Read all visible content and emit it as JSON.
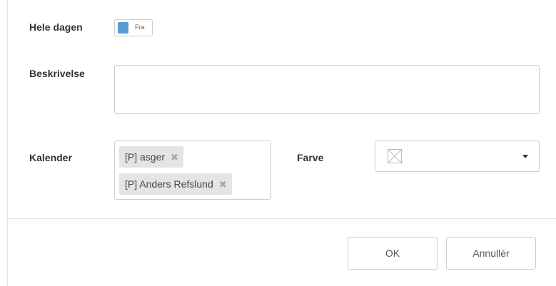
{
  "form": {
    "all_day": {
      "label": "Hele dagen",
      "toggle_text": "Fra",
      "toggle_color": "#5b9bd5"
    },
    "description": {
      "label": "Beskrivelse",
      "value": "",
      "placeholder": ""
    },
    "calendar": {
      "label": "Kalender",
      "selected": [
        {
          "label": "[P] asger",
          "remove_icon": "close-icon"
        },
        {
          "label": "[P] Anders Refslund",
          "remove_icon": "close-icon"
        }
      ]
    },
    "color": {
      "label": "Farve",
      "selected_icon": "no-color-icon",
      "dropdown_icon": "caret-down-icon"
    }
  },
  "footer": {
    "ok_label": "OK",
    "cancel_label": "Annullér"
  }
}
